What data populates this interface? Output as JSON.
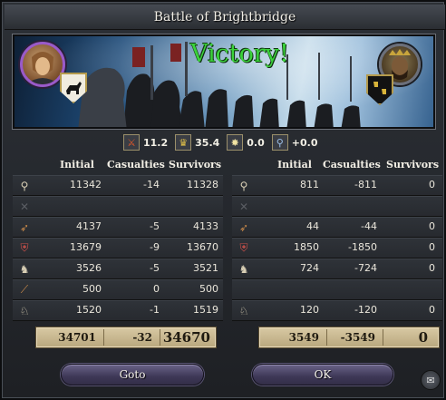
{
  "window": {
    "title": "Battle of Brightbridge"
  },
  "banner": {
    "result": "Victory!",
    "result_color": "#3bd23b",
    "left_portrait": "attacker-commander-portrait",
    "right_portrait": "defender-commander-portrait",
    "left_coat_of_arms": "white-horse-shield-icon",
    "right_coat_of_arms": "gold-lions-shield-icon"
  },
  "stats": [
    {
      "icon": "crossed-swords-icon",
      "value": "11.2"
    },
    {
      "icon": "crown-icon",
      "value": "35.4"
    },
    {
      "icon": "star-burst-icon",
      "value": "0.0"
    },
    {
      "icon": "scepter-icon",
      "value": "+0.0"
    }
  ],
  "headers": {
    "initial": "Initial",
    "casualties": "Casualties",
    "survivors": "Survivors"
  },
  "attacker": {
    "rows": [
      {
        "icon": "levy-icon",
        "initial": "11342",
        "casualties": "-14",
        "survivors": "11328"
      },
      {
        "icon": "crossed-pikes-icon",
        "initial": "",
        "casualties": "",
        "survivors": ""
      },
      {
        "icon": "archer-icon",
        "initial": "4137",
        "casualties": "-5",
        "survivors": "4133"
      },
      {
        "icon": "heavy-infantry-icon",
        "initial": "13679",
        "casualties": "-9",
        "survivors": "13670"
      },
      {
        "icon": "light-cavalry-icon",
        "initial": "3526",
        "casualties": "-5",
        "survivors": "3521"
      },
      {
        "icon": "spear-icon",
        "initial": "500",
        "casualties": "0",
        "survivors": "500"
      },
      {
        "icon": "knight-icon",
        "initial": "1520",
        "casualties": "-1",
        "survivors": "1519"
      }
    ],
    "totals": {
      "initial": "34701",
      "casualties": "-32",
      "survivors": "34670"
    }
  },
  "defender": {
    "rows": [
      {
        "icon": "levy-icon",
        "initial": "811",
        "casualties": "-811",
        "survivors": "0"
      },
      {
        "icon": "crossed-pikes-icon",
        "initial": "",
        "casualties": "",
        "survivors": ""
      },
      {
        "icon": "archer-icon",
        "initial": "44",
        "casualties": "-44",
        "survivors": "0"
      },
      {
        "icon": "heavy-infantry-icon",
        "initial": "1850",
        "casualties": "-1850",
        "survivors": "0"
      },
      {
        "icon": "light-cavalry-icon",
        "initial": "724",
        "casualties": "-724",
        "survivors": "0"
      },
      {
        "icon": "spear-icon",
        "initial": "",
        "casualties": "",
        "survivors": ""
      },
      {
        "icon": "knight-icon",
        "initial": "120",
        "casualties": "-120",
        "survivors": "0"
      }
    ],
    "totals": {
      "initial": "3549",
      "casualties": "-3549",
      "survivors": "0"
    }
  },
  "buttons": {
    "goto": "Goto",
    "ok": "OK"
  },
  "footer": {
    "mail_icon": "envelope-icon"
  }
}
